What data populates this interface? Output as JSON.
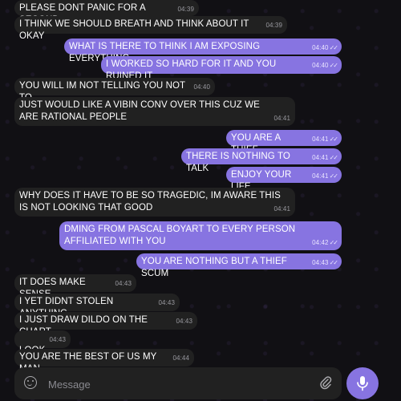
{
  "messages": [
    {
      "dir": "in",
      "text": "PLEASE DONT PANIC FOR A SECOND",
      "time": "04:39"
    },
    {
      "dir": "in",
      "text": "I THINK WE SHOULD BREATH AND THINK ABOUT IT OKAY",
      "time": "04:39"
    },
    {
      "dir": "out",
      "text": "WHAT IS THERE TO THINK I AM EXPOSING EVERYTHING",
      "time": "04:40"
    },
    {
      "dir": "out",
      "text": "I WORKED SO HARD FOR IT AND YOU RUINED IT",
      "time": "04:40"
    },
    {
      "dir": "in",
      "text": "YOU WILL IM NOT TELLING YOU NOT TO",
      "time": "04:40"
    },
    {
      "dir": "in",
      "text": "JUST WOULD LIKE A VIBIN CONV OVER THIS CUZ WE ARE RATIONAL PEOPLE",
      "time": "04:41"
    },
    {
      "dir": "out",
      "text": "YOU  ARE A THIEF",
      "time": "04:41"
    },
    {
      "dir": "out",
      "text": "THERE IS NOTHING TO TALK",
      "time": "04:41"
    },
    {
      "dir": "out",
      "text": "ENJOY YOUR LIFE",
      "time": "04:41"
    },
    {
      "dir": "in",
      "text": "WHY DOES IT HAVE TO BE SO TRAGEDIC, IM AWARE THIS IS NOT LOOKING THAT GOOD",
      "time": "04:41"
    },
    {
      "dir": "out",
      "text": "DMING FROM PASCAL BOYART TO EVERY PERSON AFFILIATED WITH  YOU",
      "time": "04:42"
    },
    {
      "dir": "out",
      "text": "YOU ARE NOTHING BUT A THIEF SCUM",
      "time": "04:43"
    },
    {
      "dir": "in",
      "text": "IT DOES MAKE SENSE",
      "time": "04:43"
    },
    {
      "dir": "in",
      "text": "I YET DIDNT STOLEN ANYTHING",
      "time": "04:43"
    },
    {
      "dir": "in",
      "text": "I JUST DRAW DILDO ON THE CHART",
      "time": "04:43"
    },
    {
      "dir": "in",
      "text": "LOOK",
      "time": "04:43"
    },
    {
      "dir": "in",
      "text": "YOU ARE THE BEST OF US MY MAN",
      "time": "04:44"
    }
  ],
  "composer": {
    "placeholder": "Message"
  },
  "icons": {
    "emoji": "emoji-icon",
    "attach": "paperclip-icon",
    "mic": "microphone-icon"
  },
  "colors": {
    "outgoing": "#8774e1",
    "incoming": "#212121",
    "background": "#111014"
  }
}
